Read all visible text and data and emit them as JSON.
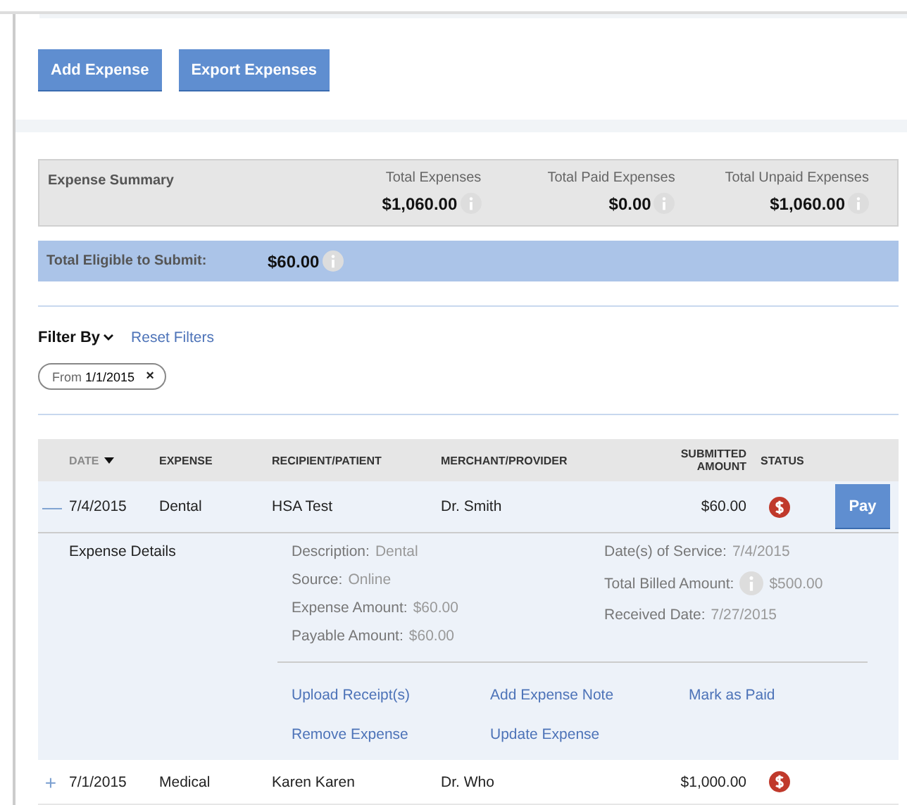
{
  "actions": [
    "Add Expense",
    "Export Expenses"
  ],
  "summary": {
    "title": "Expense Summary",
    "totals": [
      {
        "label": "Total Expenses",
        "value": "$1,060.00"
      },
      {
        "label": "Total Paid Expenses",
        "value": "$0.00"
      },
      {
        "label": "Total Unpaid Expenses",
        "value": "$1,060.00"
      }
    ]
  },
  "eligible": {
    "label": "Total Eligible to Submit:",
    "value": "$60.00"
  },
  "filter": {
    "label": "Filter By",
    "reset": "Reset Filters",
    "chips": [
      {
        "label": "From",
        "value": "1/1/2015",
        "remove": "×"
      }
    ]
  },
  "table": {
    "columns": [
      "DATE",
      "EXPENSE",
      "RECIPIENT/PATIENT",
      "MERCHANT/PROVIDER",
      "SUBMITTED AMOUNT",
      "STATUS"
    ],
    "rows": [
      {
        "expanded": true,
        "toggle": "—",
        "date": "7/4/2015",
        "expense": "Dental",
        "recipient": "HSA Test",
        "merchant": "Dr. Smith",
        "amount": "$60.00",
        "pay": "Pay",
        "details": {
          "title": "Expense Details",
          "left": [
            {
              "label": "Description:",
              "value": "Dental"
            },
            {
              "label": "Source:",
              "value": "Online"
            },
            {
              "label": "Expense Amount:",
              "value": "$60.00"
            },
            {
              "label": "Payable Amount:",
              "value": "$60.00"
            }
          ],
          "right": [
            {
              "label": "Date(s) of Service:",
              "value": "7/4/2015",
              "info": false
            },
            {
              "label": "Total Billed Amount:",
              "value": "$500.00",
              "info": true
            },
            {
              "label": "Received Date:",
              "value": "7/27/2015",
              "info": false
            }
          ],
          "links": [
            "Upload Receipt(s)",
            "Add Expense Note",
            "Mark as Paid",
            "Remove Expense",
            "Update Expense"
          ]
        }
      },
      {
        "expanded": false,
        "toggle": "+",
        "date": "7/1/2015",
        "expense": "Medical",
        "recipient": "Karen Karen",
        "merchant": "Dr. Who",
        "amount": "$1,000.00"
      }
    ]
  }
}
